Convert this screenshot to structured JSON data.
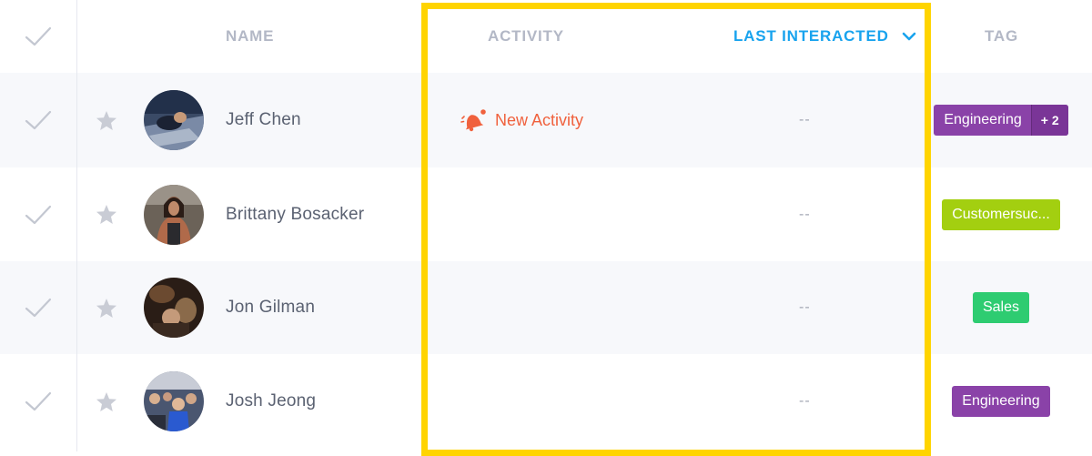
{
  "header": {
    "select_all_icon": "checkmark-icon",
    "columns": {
      "name": "NAME",
      "activity": "ACTIVITY",
      "last_interacted": "LAST INTERACTED",
      "tag": "TAG"
    },
    "sort_icon": "chevron-down-icon",
    "sort_color": "#18a3ee"
  },
  "rows": [
    {
      "name": "Jeff Chen",
      "activity": "New Activity",
      "activity_icon": "bell-notification-icon",
      "last_interacted": "--",
      "tag": "Engineering",
      "tag_more": "+ 2",
      "tag_color": "#8a42a8"
    },
    {
      "name": "Brittany Bosacker",
      "activity": "",
      "last_interacted": "--",
      "tag": "Customersuc...",
      "tag_color": "#a3cf10"
    },
    {
      "name": "Jon Gilman",
      "activity": "",
      "last_interacted": "--",
      "tag": "Sales",
      "tag_color": "#2ecc71"
    },
    {
      "name": "Josh Jeong",
      "activity": "",
      "last_interacted": "--",
      "tag": "Engineering",
      "tag_color": "#8a42a8"
    }
  ],
  "highlight_color": "#ffd400"
}
